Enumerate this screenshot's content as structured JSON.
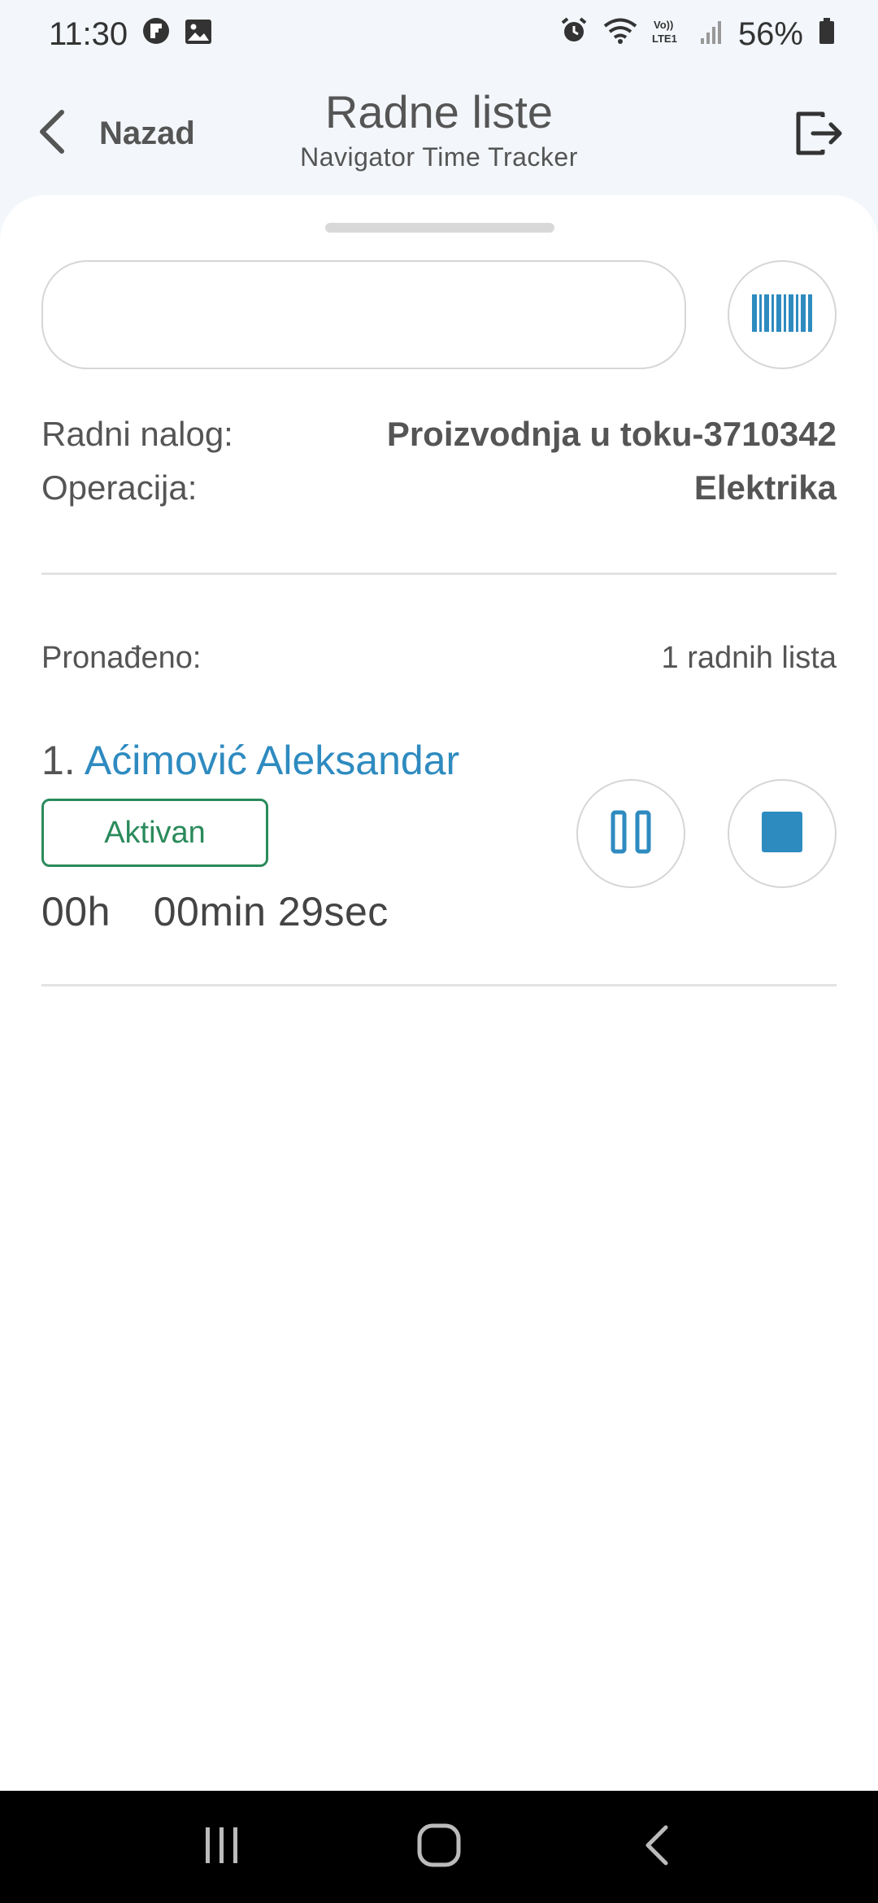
{
  "status_bar": {
    "time": "11:30",
    "battery": "56%",
    "icons": [
      "flipboard-icon",
      "gallery-icon",
      "alarm-icon",
      "wifi-icon",
      "volte-icon",
      "signal-icon",
      "battery-icon"
    ]
  },
  "header": {
    "back_label": "Nazad",
    "title": "Radne liste",
    "subtitle": "Navigator Time Tracker"
  },
  "search": {
    "value": "",
    "placeholder": ""
  },
  "work_order": {
    "label": "Radni nalog:",
    "value": "Proizvodnja u toku-3710342"
  },
  "operation": {
    "label": "Operacija:",
    "value": "Elektrika"
  },
  "results": {
    "found_label": "Pronađeno:",
    "found_count": "1 radnih lista"
  },
  "worksheets": [
    {
      "index": "1.",
      "name": "Aćimović Aleksandar",
      "status": "Aktivan",
      "hours": "00h",
      "minutes": "00min",
      "seconds": "29sec"
    }
  ],
  "colors": {
    "accent": "#2e8bc0",
    "active_status": "#2a8a5b",
    "background": "#f3f6fb",
    "sheet": "#ffffff"
  }
}
